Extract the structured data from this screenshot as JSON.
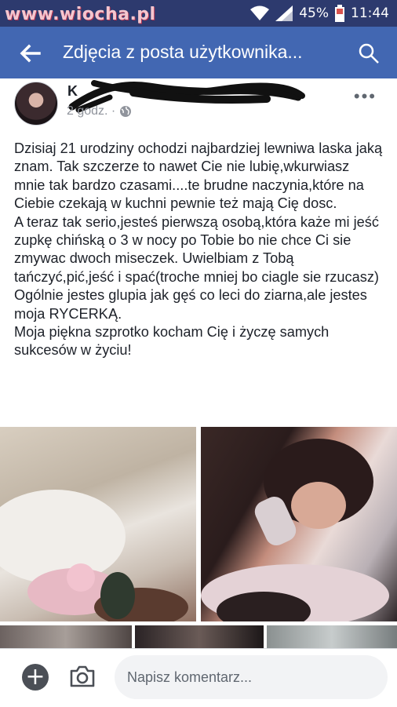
{
  "status_bar": {
    "watermark": "www.wiocha.pl",
    "battery": "45%",
    "time": "11:44",
    "icons": [
      "wifi-icon",
      "signal-icon",
      "battery-icon"
    ]
  },
  "app_bar": {
    "title": "Zdjęcia z posta użytkownika...",
    "back_icon": "arrow-left-icon",
    "search_icon": "search-icon",
    "background": "#4267b2"
  },
  "post": {
    "author": "K",
    "time": "2 godz. ·",
    "privacy_icon": "globe-icon",
    "more_icon": "more-horizontal-icon",
    "text_lines": [
      "Dzisiaj 21 urodziny ochodzi najbardziej lewniwa laska jaką znam. Tak szczerze to nawet Cie nie lubię,wkurwiasz mnie tak bardzo czasami....te brudne naczynia,które na Ciebie czekają w kuchni pewnie też mają Cię dosc.",
      "A teraz tak serio,jesteś pierwszą osobą,która każe mi jeść zupkę chińską o 3 w nocy po Tobie bo nie chce Ci sie zmywac dwoch miseczek. Uwielbiam z Tobą tańczyć,pić,jeść i spać(troche mniej bo ciagle sie rzucasz)",
      "Ogólnie jestes glupia jak gęś co leci do ziarna,ale jestes moja RYCERKĄ.",
      "Moja piękna szprotko kocham Cię i życzę samych sukcesów w życiu!"
    ]
  },
  "comment_bar": {
    "placeholder": "Napisz komentarz...",
    "add_icon": "plus-circle-icon",
    "camera_icon": "camera-icon"
  }
}
